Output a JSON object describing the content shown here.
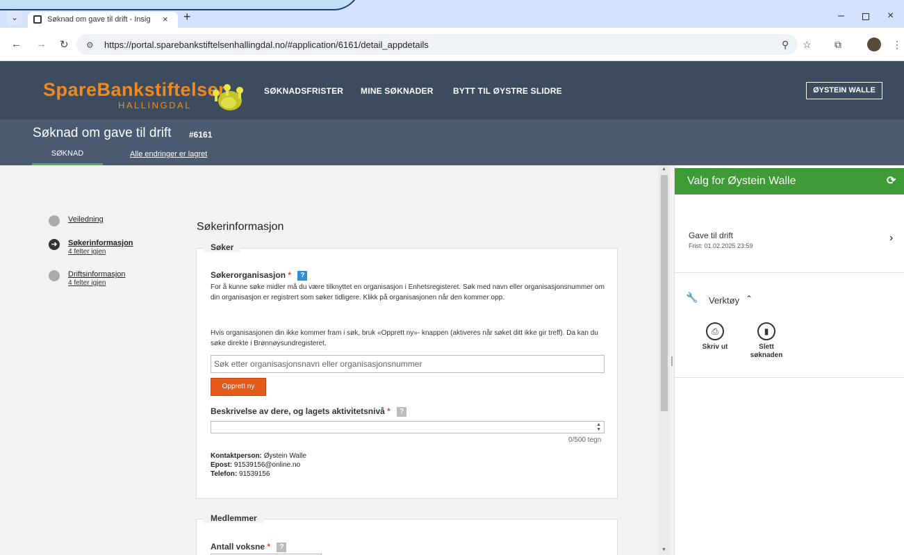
{
  "browser": {
    "tab_title": "Søknad om gave til drift - Insig",
    "tab_close": "×",
    "new_tab": "+",
    "url": "https://portal.sparebankstiftelsenhallingdal.no/#application/6161/detail_appdetails",
    "window_min": "–",
    "window_close": "×"
  },
  "site": {
    "logo_main": "SpareBankstiftelsen",
    "logo_sub": "HALLINGDAL",
    "nav": [
      "SØKNADSFRISTER",
      "MINE SØKNADER",
      "BYTT TIL ØYSTRE SLIDRE"
    ],
    "user_button": "ØYSTEIN WALLE"
  },
  "application": {
    "title": "Søknad om gave til drift",
    "id": "#6161",
    "tab": "SØKNAD",
    "saved_status": "Alle endringer er lagret"
  },
  "steps": [
    {
      "label": "Veiledning",
      "sub": ""
    },
    {
      "label": "Søkerinformasjon",
      "sub": "4 felter igjen"
    },
    {
      "label": "Driftsinformasjon",
      "sub": "4 felter igjen"
    }
  ],
  "form": {
    "section_title": "Søkerinformasjon",
    "soker_legend": "Søker",
    "org_label": "Søkerorganisasjon",
    "required_mark": "*",
    "help_mark": "?",
    "org_help_1": "For å kunne søke midler må du være tilknyttet en organisasjon i Enhetsregisteret. Søk med navn eller organisasjonsnummer om din organisasjon er registrert som søker tidligere. Klikk på organisasjonen når den kommer opp.",
    "org_help_2": "Hvis organisasjonen din ikke kommer fram i søk, bruk «Opprett ny»- knappen (aktiveres når søket ditt ikke gir treff). Da kan du søke direkte i Brønnøysundregisteret.",
    "search_placeholder": "Søk etter organisasjonsnavn eller organisasjonsnummer",
    "new_button": "Opprett ny",
    "description_label": "Beskrivelse av dere, og lagets aktivitetsnivå",
    "counter": "0/500 tegn",
    "contact_label": "Kontaktperson:",
    "contact_value": "Øystein Walle",
    "email_label": "Epost:",
    "email_value": "91539156@online.no",
    "phone_label": "Telefon:",
    "phone_value": "91539156",
    "members_legend": "Medlemmer",
    "adults_label": "Antall voksne"
  },
  "right_panel": {
    "title": "Valg for Øystein Walle",
    "grant_name": "Gave til drift",
    "deadline": "Frist: 01.02.2025 23:59",
    "tools_label": "Verktøy",
    "print_label": "Skriv ut",
    "delete_label": "Slett søknaden"
  },
  "colors": {
    "header_bg": "#3d4b5f",
    "subheader_bg": "#4a5a70",
    "logo_orange": "#f08a1f",
    "panel_green": "#3e9a34",
    "button_orange": "#e35a1a",
    "help_blue": "#2f8fd5"
  },
  "icons": {
    "refresh": "⟳",
    "chevron_right": "›",
    "wrench": "🔧",
    "print": "⎙",
    "trash": "🗑"
  }
}
